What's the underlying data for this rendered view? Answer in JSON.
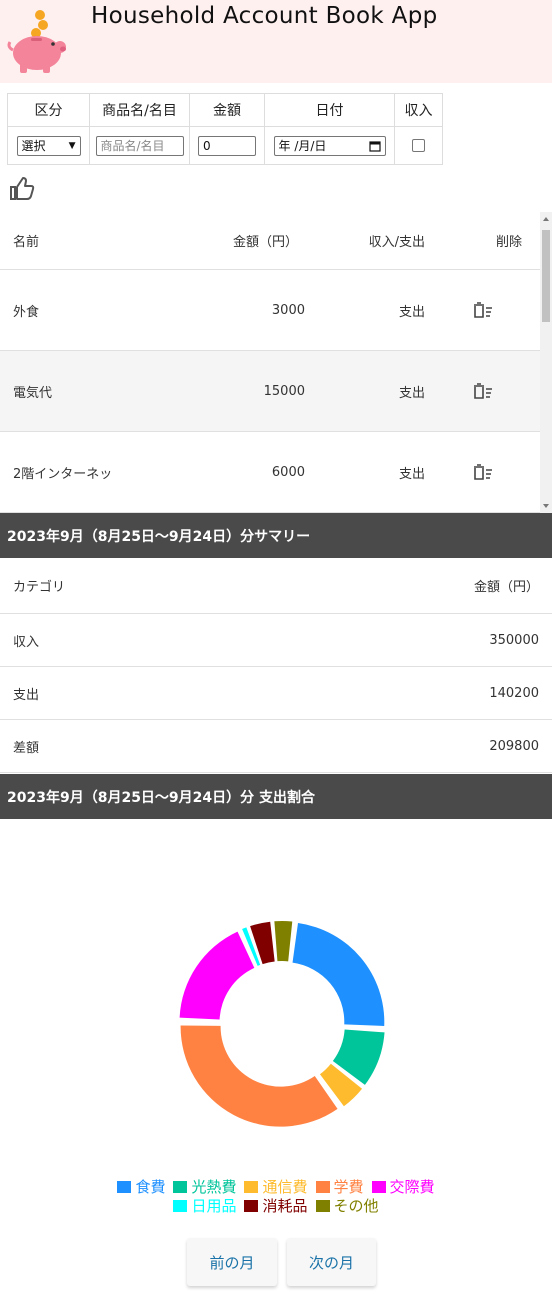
{
  "header": {
    "title": "Household Account Book App",
    "logo_icon": "piggy-bank-icon"
  },
  "form": {
    "headers": [
      "区分",
      "商品名/名目",
      "金額",
      "日付",
      "収入"
    ],
    "category_select_value": "選択",
    "name_placeholder": "商品名/名目",
    "amount_value": "0",
    "date_value": "年 /月/日"
  },
  "like_icon": "thumbs-up-icon",
  "list": {
    "headers": [
      "名前",
      "金額（円）",
      "収入/支出",
      "削除"
    ],
    "rows": [
      {
        "name": "外食",
        "amount": "3000",
        "type": "支出"
      },
      {
        "name": "電気代",
        "amount": "15000",
        "type": "支出"
      },
      {
        "name": "2階インターネッ",
        "amount": "6000",
        "type": "支出"
      }
    ]
  },
  "summary": {
    "title": "2023年9月（8月25日〜9月24日）分サマリー",
    "headers": [
      "カテゴリ",
      "金額（円）"
    ],
    "rows": [
      {
        "label": "収入",
        "value": "350000"
      },
      {
        "label": "支出",
        "value": "140200"
      },
      {
        "label": "差額",
        "value": "209800"
      }
    ]
  },
  "ratio": {
    "title": "2023年9月（8月25日〜9月24日）分  支出割合"
  },
  "chart_data": {
    "type": "pie",
    "donut": true,
    "categories": [
      "食費",
      "光熱費",
      "通信費",
      "学費",
      "交際費",
      "日用品",
      "消耗品",
      "その他"
    ],
    "values": [
      22.5,
      9.0,
      4.3,
      33.2,
      16.8,
      1.2,
      3.6,
      3.2
    ],
    "colors": [
      "#1e90ff",
      "#00c49a",
      "#fdbb2d",
      "#ff8243",
      "#ff00ff",
      "#00ffff",
      "#800000",
      "#808000"
    ],
    "legend_position": "bottom"
  },
  "nav": {
    "prev_label": "前の月",
    "next_label": "次の月"
  }
}
